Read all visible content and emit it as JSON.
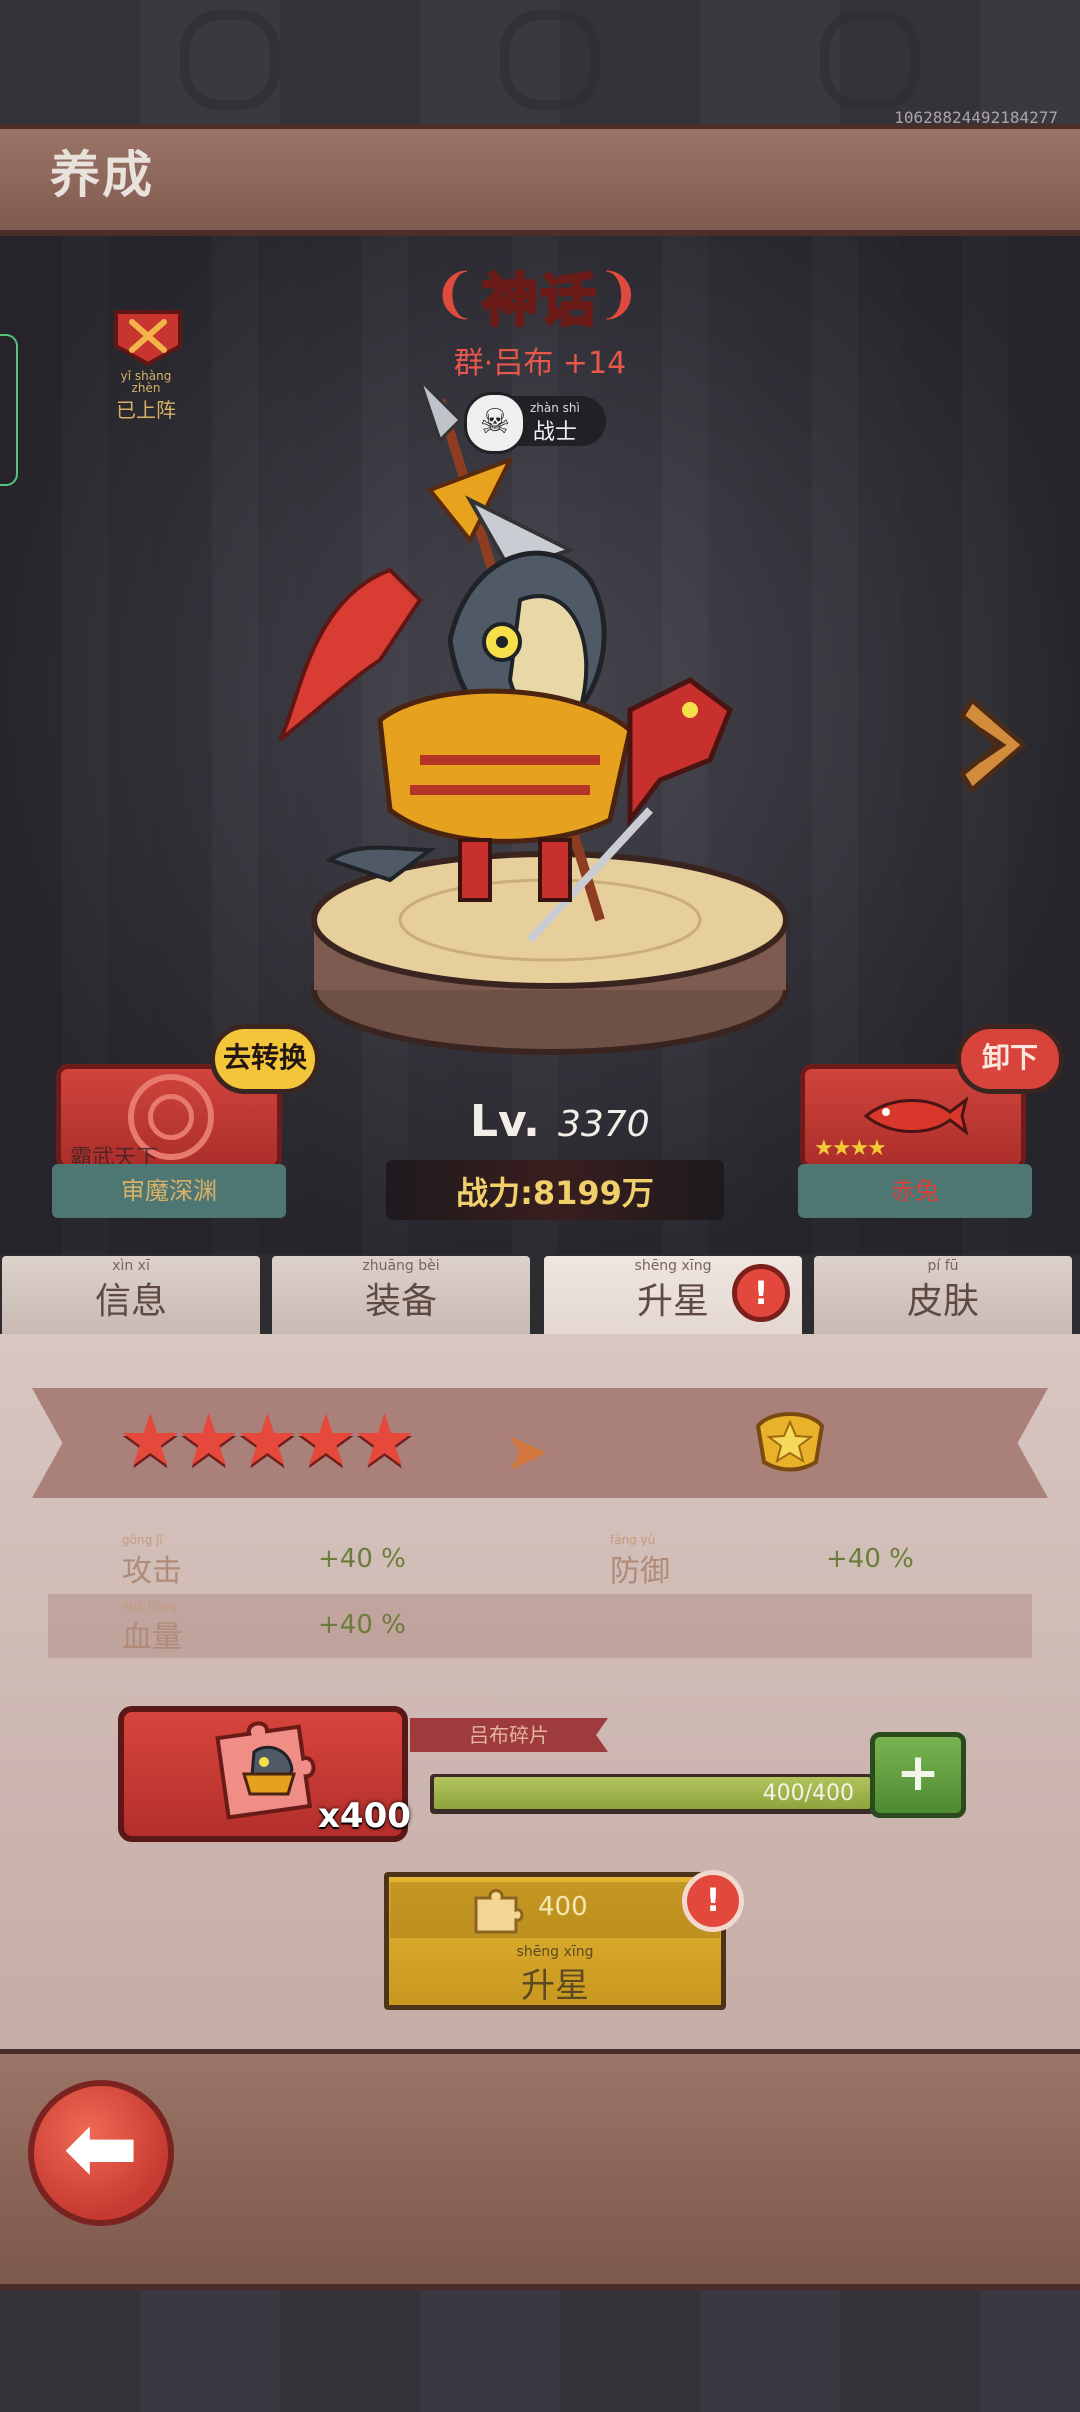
{
  "debug_id": "10628824492184277",
  "header": {
    "title": "养成"
  },
  "hero": {
    "rarity": "神话",
    "name": "群·吕布 +14",
    "class_label": "战士",
    "class_pinyin": "zhàn shì",
    "deployed_label": "已上阵",
    "deployed_pinyin": "yǐ shàng zhèn",
    "level_prefix": "Lv.",
    "level": "3370",
    "power": "战力:8199万"
  },
  "left_card": {
    "bubble": "去转换",
    "title": "霸武天下",
    "footer": "审魔深渊"
  },
  "right_card": {
    "bubble": "卸下",
    "stars": 4,
    "footer": "赤兔"
  },
  "tabs": [
    {
      "label": "信息",
      "pinyin": "xìn xī"
    },
    {
      "label": "装备",
      "pinyin": "zhuāng bèi"
    },
    {
      "label": "升星",
      "pinyin": "shēng xīng",
      "active": true,
      "alert": "!"
    },
    {
      "label": "皮肤",
      "pinyin": "pí fū"
    }
  ],
  "star_panel": {
    "current_stars": 5,
    "stats": [
      {
        "label": "攻击",
        "pinyin": "gōng jī",
        "value": "+40 %"
      },
      {
        "label": "防御",
        "pinyin": "fáng yù",
        "value": "+40 %"
      },
      {
        "label": "血量",
        "pinyin": "xuè liàng",
        "value": "+40 %"
      }
    ]
  },
  "fragment": {
    "name": "吕布碎片",
    "count": "x400",
    "progress_text": "400/400",
    "progress_fraction": 1.0,
    "plus_label": "+"
  },
  "upgrade": {
    "cost": "400",
    "label": "升星",
    "label_pinyin": "shēng xīng",
    "alert": "!"
  },
  "colors": {
    "accent_red": "#d8443c",
    "gold": "#e4b534",
    "green": "#6aa545",
    "wood": "#8b6558"
  },
  "icons": {
    "back": "arrow-left-icon",
    "next": "chevron-right-icon",
    "class": "warrior-mask-icon",
    "deployed": "crossed-swords-badge-icon",
    "cost": "puzzle-piece-icon",
    "crown": "gold-star-crown-icon"
  }
}
